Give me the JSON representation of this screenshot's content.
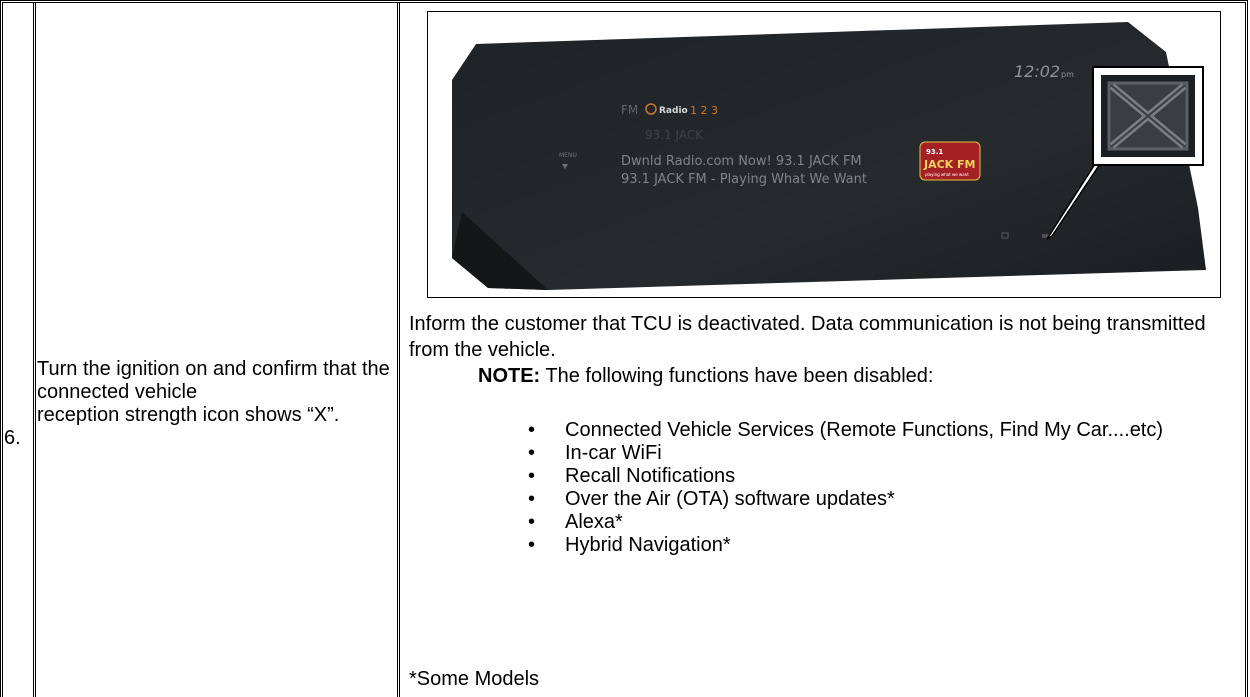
{
  "step": {
    "number": "6.",
    "instruction": "Turn the ignition on and confirm that the connected vehicle\nreception strength icon shows “X”."
  },
  "figure": {
    "radio_band": "FM",
    "hd_label": "Radio",
    "presets": "1 2 3",
    "station_title": "93.1 JACK",
    "rds_line1": "Dwnld Radio.com Now!  93.1 JACK FM",
    "rds_line2": "93.1 JACK FM - Playing What We Want",
    "clock": "12:02",
    "clock_suffix": "pm",
    "menu_label": "MENU",
    "logo_frequency": "93.1",
    "logo_text": "JACK FM",
    "logo_tagline": "playing what we want"
  },
  "content": {
    "inform_text": "Inform the customer that TCU is deactivated. Data communication is not being transmitted from the vehicle.",
    "note_label": "NOTE:",
    "note_text": " The following functions have been disabled:",
    "functions": [
      "Connected Vehicle Services (Remote Functions, Find My Car....etc)",
      "In-car WiFi",
      "Recall Notifications",
      "Over the Air (OTA) software updates*",
      "Alexa*",
      "Hybrid Navigation*"
    ],
    "footnote": "*Some Models"
  }
}
